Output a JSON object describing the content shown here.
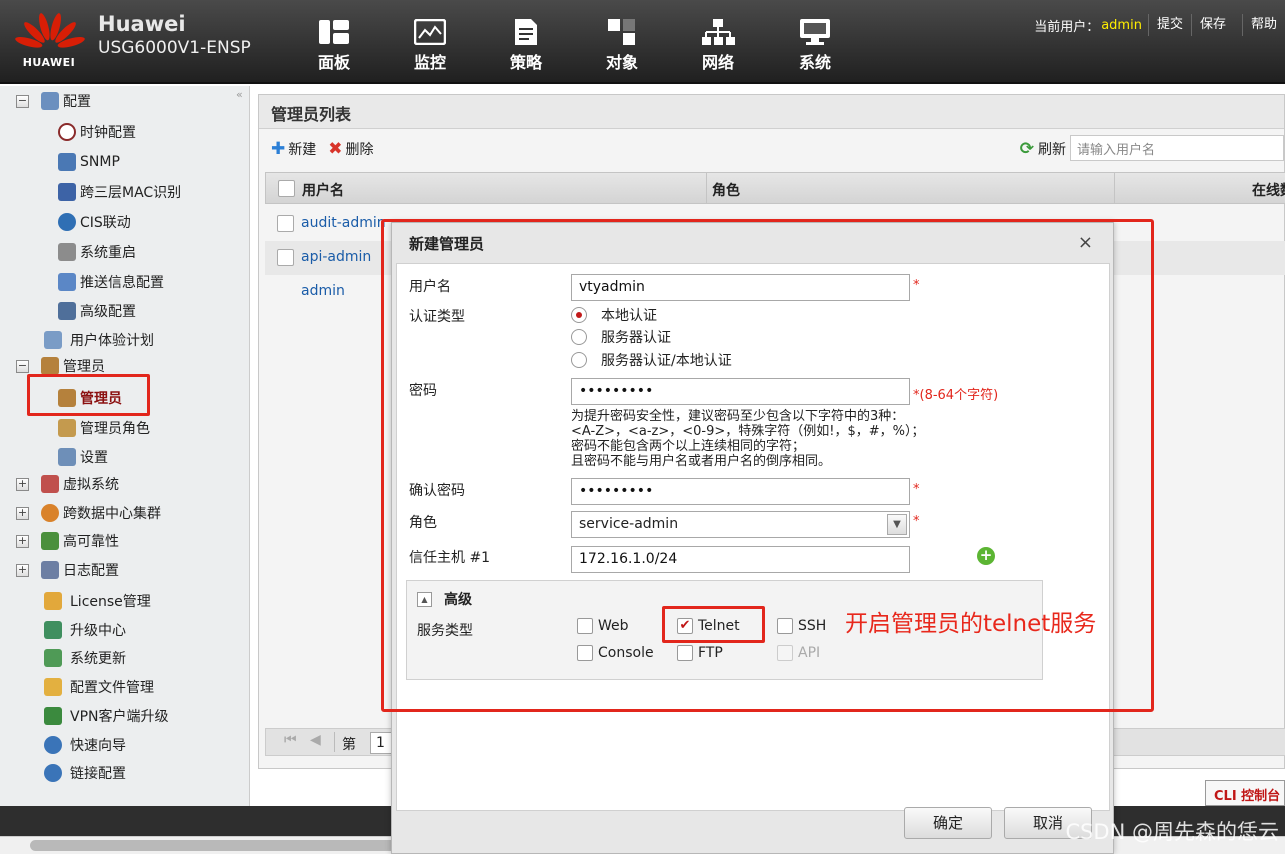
{
  "brand": {
    "logo_text": "HUAWEI",
    "name": "Huawei",
    "model": "USG6000V1-ENSP"
  },
  "nav": [
    {
      "label": "面板",
      "icon": "dashboard-icon"
    },
    {
      "label": "监控",
      "icon": "monitor-icon"
    },
    {
      "label": "策略",
      "icon": "policy-icon"
    },
    {
      "label": "对象",
      "icon": "object-icon"
    },
    {
      "label": "网络",
      "icon": "network-icon"
    },
    {
      "label": "系统",
      "icon": "system-icon"
    }
  ],
  "userbar": {
    "current_user_label": "当前用户：",
    "username": "admin",
    "submit": "提交",
    "save": "保存",
    "help": "帮助"
  },
  "sidebar": {
    "collapse": "«",
    "items": [
      {
        "label": "配置",
        "expander": "−"
      },
      {
        "label": "时钟配置"
      },
      {
        "label": "SNMP"
      },
      {
        "label": "跨三层MAC识别"
      },
      {
        "label": "CIS联动"
      },
      {
        "label": "系统重启"
      },
      {
        "label": "推送信息配置"
      },
      {
        "label": "高级配置"
      },
      {
        "label": "用户体验计划"
      },
      {
        "label": "管理员",
        "expander": "−"
      },
      {
        "label": "管理员",
        "selected": true
      },
      {
        "label": "管理员角色"
      },
      {
        "label": "设置"
      },
      {
        "label": "虚拟系统",
        "expander": "+"
      },
      {
        "label": "跨数据中心集群",
        "expander": "+"
      },
      {
        "label": "高可靠性",
        "expander": "+"
      },
      {
        "label": "日志配置",
        "expander": "+"
      },
      {
        "label": "License管理"
      },
      {
        "label": "升级中心"
      },
      {
        "label": "系统更新"
      },
      {
        "label": "配置文件管理"
      },
      {
        "label": "VPN客户端升级"
      },
      {
        "label": "快速向导"
      },
      {
        "label": "链接配置"
      }
    ]
  },
  "content": {
    "title": "管理员列表",
    "toolbar": {
      "new": "新建",
      "delete": "删除",
      "refresh": "刷新"
    },
    "search": {
      "placeholder": "请输入用户名"
    },
    "columns": {
      "username": "用户名",
      "role": "角色",
      "online": "在线数"
    },
    "rows": [
      "audit-admin",
      "api-admin",
      "admin"
    ],
    "pager": {
      "page_label": "第",
      "page": "1"
    },
    "cli": "CLI 控制台"
  },
  "dialog": {
    "title": "新建管理员",
    "close": "×",
    "username_label": "用户名",
    "username_value": "vtyadmin",
    "auth_label": "认证类型",
    "auth_options": [
      "本地认证",
      "服务器认证",
      "服务器认证/本地认证"
    ],
    "auth_selected": 0,
    "password_label": "密码",
    "password_value": "•••••••••",
    "password_req": "*(8-64个字符)",
    "hint_lines": [
      "为提升密码安全性，建议密码至少包含以下字符中的3种：",
      "<A-Z>，<a-z>，<0-9>，特殊字符（例如!，$，#，%）；",
      "密码不能包含两个以上连续相同的字符；",
      "且密码不能与用户名或者用户名的倒序相同。"
    ],
    "confirm_label": "确认密码",
    "confirm_value": "•••••••••",
    "role_label": "角色",
    "role_value": "service-admin",
    "trusted_label": "信任主机 #1",
    "trusted_value": "172.16.1.0/24",
    "advanced": "高级",
    "service_label": "服务类型",
    "services": [
      {
        "label": "Web",
        "checked": false,
        "disabled": false
      },
      {
        "label": "Telnet",
        "checked": true,
        "disabled": false
      },
      {
        "label": "SSH",
        "checked": false,
        "disabled": false
      },
      {
        "label": "Console",
        "checked": false,
        "disabled": false
      },
      {
        "label": "FTP",
        "checked": false,
        "disabled": false
      },
      {
        "label": "API",
        "checked": false,
        "disabled": true
      }
    ],
    "ok": "确定",
    "cancel": "取消",
    "required_mark": "*"
  },
  "annotation": "开启管理员的telnet服务",
  "watermark": "CSDN @周先森的恁云",
  "colors": {
    "accent_red": "#e2261c",
    "user_yellow": "#ffee00",
    "link_blue": "#1a5ca8"
  }
}
